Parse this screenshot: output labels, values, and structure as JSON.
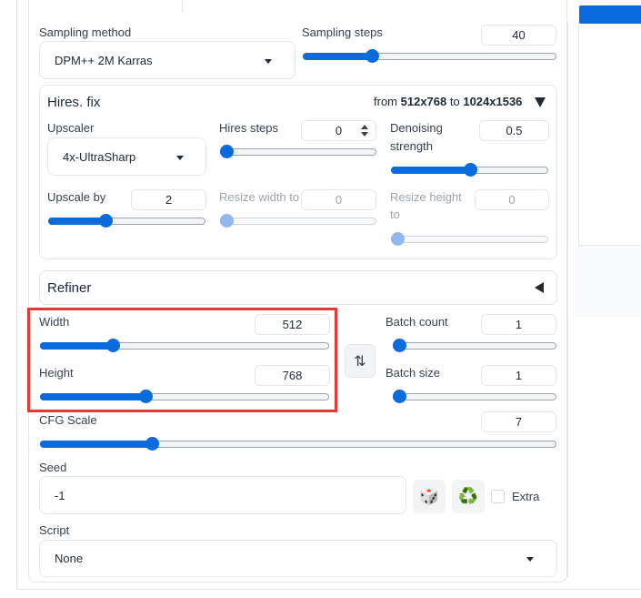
{
  "sampling": {
    "method_label": "Sampling method",
    "method_value": "DPM++ 2M Karras",
    "steps_label": "Sampling steps",
    "steps_value": "40",
    "steps_level": 0.26
  },
  "hires": {
    "title": "Hires. fix",
    "range_from_prefix": "from",
    "range_from": "512x768",
    "range_to_prefix": "to",
    "range_to": "1024x1536",
    "upscaler_label": "Upscaler",
    "upscaler_value": "4x-UltraSharp",
    "steps_label": "Hires steps",
    "steps_value": "0",
    "steps_level": 0.0,
    "denoise_label": "Denoising",
    "denoise_label2": "strength",
    "denoise_value": "0.5",
    "denoise_level": 0.5,
    "upscale_by_label": "Upscale by",
    "upscale_by_value": "2",
    "upscale_by_level": 0.35,
    "resize_width_label": "Resize width to",
    "resize_width_value": "0",
    "resize_width_level": 0.0,
    "resize_height_label": "Resize height",
    "resize_height_label2": "to",
    "resize_height_value": "0",
    "resize_height_level": 0.0
  },
  "refiner": {
    "title": "Refiner"
  },
  "size": {
    "width_label": "Width",
    "width_value": "512",
    "width_level": 0.24,
    "height_label": "Height",
    "height_value": "768",
    "height_level": 0.36
  },
  "batch": {
    "count_label": "Batch count",
    "count_value": "1",
    "count_level": 0.0,
    "size_label": "Batch size",
    "size_value": "1",
    "size_level": 0.0
  },
  "cfg": {
    "label": "CFG Scale",
    "value": "7",
    "level": 0.21
  },
  "seed": {
    "label": "Seed",
    "value": "-1",
    "extra_label": "Extra",
    "dice_icon": "🎲",
    "recycle_icon": "♻️"
  },
  "script": {
    "label": "Script",
    "value": "None"
  },
  "colors": {
    "accent": "#0b6bdc",
    "highlight": "#e53935"
  }
}
